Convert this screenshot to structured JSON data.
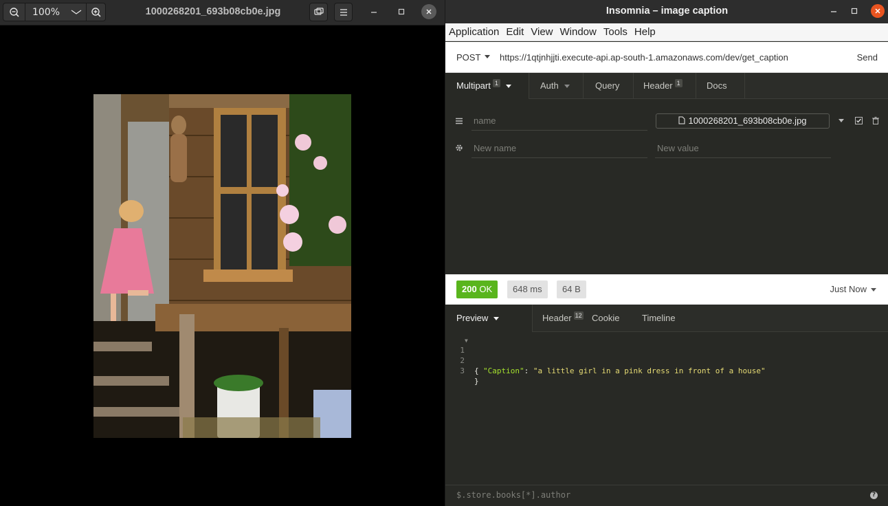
{
  "viewer": {
    "zoom_label": "100%",
    "title": "1000268201_693b08cb0e.jpg",
    "icons": [
      "zoom-out-icon",
      "chevron-down-icon",
      "zoom-in-icon",
      "slideshow-icon",
      "hamburger-menu-icon",
      "minimize-icon",
      "maximize-icon",
      "close-icon"
    ]
  },
  "insomnia": {
    "window_title": "Insomnia – image caption",
    "menu": [
      "Application",
      "Edit",
      "View",
      "Window",
      "Tools",
      "Help"
    ],
    "request": {
      "method": "POST",
      "url": "https://1qtjnhjjti.execute-api.ap-south-1.amazonaws.com/dev/get_caption",
      "send_label": "Send"
    },
    "request_tabs": {
      "multipart": "Multipart",
      "multipart_count": "1",
      "auth": "Auth",
      "query": "Query",
      "header": "Header",
      "header_count": "1",
      "docs": "Docs"
    },
    "multipart": {
      "row1_name_placeholder": "name",
      "row1_file": "1000268201_693b08cb0e.jpg",
      "row2_name_placeholder": "New name",
      "row2_value_placeholder": "New value"
    },
    "response": {
      "status_code": "200",
      "status_text": "OK",
      "time": "648 ms",
      "size": "64 B",
      "when": "Just Now"
    },
    "response_tabs": {
      "preview": "Preview",
      "header": "Header",
      "header_count": "12",
      "cookie": "Cookie",
      "timeline": "Timeline"
    },
    "body": {
      "line_numbers": [
        "1",
        "2",
        "3"
      ],
      "open_brace": "{",
      "key": "\"Caption\"",
      "colon": ": ",
      "value": "\"a little girl in a pink dress in front of a house\"",
      "close_brace": "}"
    },
    "filter_placeholder": "$.store.books[*].author",
    "colors": {
      "accent_ok": "#59b51d",
      "close_button": "#e95420",
      "json_key": "#a6e22e",
      "json_string": "#e6db74"
    }
  }
}
